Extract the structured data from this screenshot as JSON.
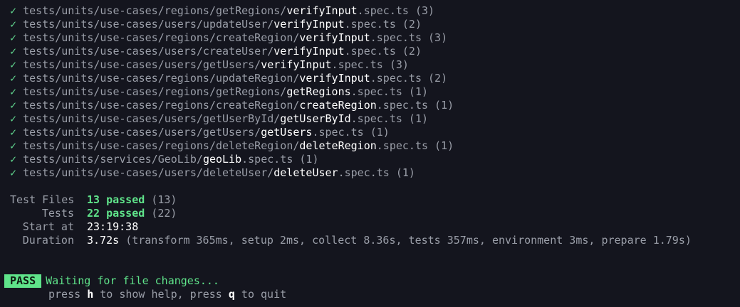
{
  "check_mark": "✓",
  "tests": [
    {
      "dir": "tests/units/use-cases/regions/getRegions/",
      "name": "verifyInput",
      "ext": ".spec.ts",
      "count": "(3)"
    },
    {
      "dir": "tests/units/use-cases/users/updateUser/",
      "name": "verifyInput",
      "ext": ".spec.ts",
      "count": "(2)"
    },
    {
      "dir": "tests/units/use-cases/regions/createRegion/",
      "name": "verifyInput",
      "ext": ".spec.ts",
      "count": "(3)"
    },
    {
      "dir": "tests/units/use-cases/users/createUser/",
      "name": "verifyInput",
      "ext": ".spec.ts",
      "count": "(2)"
    },
    {
      "dir": "tests/units/use-cases/users/getUsers/",
      "name": "verifyInput",
      "ext": ".spec.ts",
      "count": "(3)"
    },
    {
      "dir": "tests/units/use-cases/regions/updateRegion/",
      "name": "verifyInput",
      "ext": ".spec.ts",
      "count": "(2)"
    },
    {
      "dir": "tests/units/use-cases/regions/getRegions/",
      "name": "getRegions",
      "ext": ".spec.ts",
      "count": "(1)"
    },
    {
      "dir": "tests/units/use-cases/regions/createRegion/",
      "name": "createRegion",
      "ext": ".spec.ts",
      "count": "(1)"
    },
    {
      "dir": "tests/units/use-cases/users/getUserById/",
      "name": "getUserById",
      "ext": ".spec.ts",
      "count": "(1)"
    },
    {
      "dir": "tests/units/use-cases/users/getUsers/",
      "name": "getUsers",
      "ext": ".spec.ts",
      "count": "(1)"
    },
    {
      "dir": "tests/units/use-cases/regions/deleteRegion/",
      "name": "deleteRegion",
      "ext": ".spec.ts",
      "count": "(1)"
    },
    {
      "dir": "tests/units/services/GeoLib/",
      "name": "geoLib",
      "ext": ".spec.ts",
      "count": "(1)"
    },
    {
      "dir": "tests/units/use-cases/users/deleteUser/",
      "name": "deleteUser",
      "ext": ".spec.ts",
      "count": "(1)"
    }
  ],
  "summary": {
    "test_files_label": "Test Files",
    "test_files_passed": "13 passed",
    "test_files_total": "(13)",
    "tests_label": "Tests",
    "tests_passed": "22 passed",
    "tests_total": "(22)",
    "start_label": "Start at",
    "start_value": "23:19:38",
    "duration_label": "Duration",
    "duration_value": "3.72s",
    "duration_detail": "(transform 365ms, setup 2ms, collect 8.36s, tests 357ms, environment 3ms, prepare 1.79s)"
  },
  "status": {
    "badge": "PASS",
    "message": "Waiting for file changes...",
    "help_prefix": "press ",
    "help_key": "h",
    "help_mid": " to show help, press ",
    "quit_key": "q",
    "help_suffix": " to quit"
  },
  "colors": {
    "background": "#14151e",
    "pass_green": "#5fe38a",
    "check_green": "#5fd38d",
    "dim_text": "#9a9ea8",
    "bright_text": "#ffffff"
  }
}
